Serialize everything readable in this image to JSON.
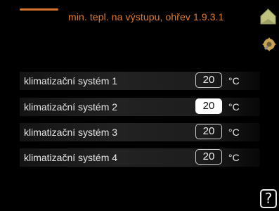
{
  "header": {
    "title": "min. tepl. na výstupu, ohřev 1.9.3.1",
    "home_icon": "home-icon",
    "settings_icon": "gear-icon"
  },
  "rows": [
    {
      "label": "klimatizační systém 1",
      "value": "20",
      "unit": "°C",
      "selected": false
    },
    {
      "label": "klimatizační systém 2",
      "value": "20",
      "unit": "°C",
      "selected": true
    },
    {
      "label": "klimatizační systém 3",
      "value": "20",
      "unit": "°C",
      "selected": false
    },
    {
      "label": "klimatizační systém 4",
      "value": "20",
      "unit": "°C",
      "selected": false
    }
  ],
  "help": {
    "label": "?"
  },
  "colors": {
    "accent": "#e07a2e",
    "text": "#e8e8e8",
    "background": "#000000",
    "home_icon": "#bdbf7a"
  }
}
